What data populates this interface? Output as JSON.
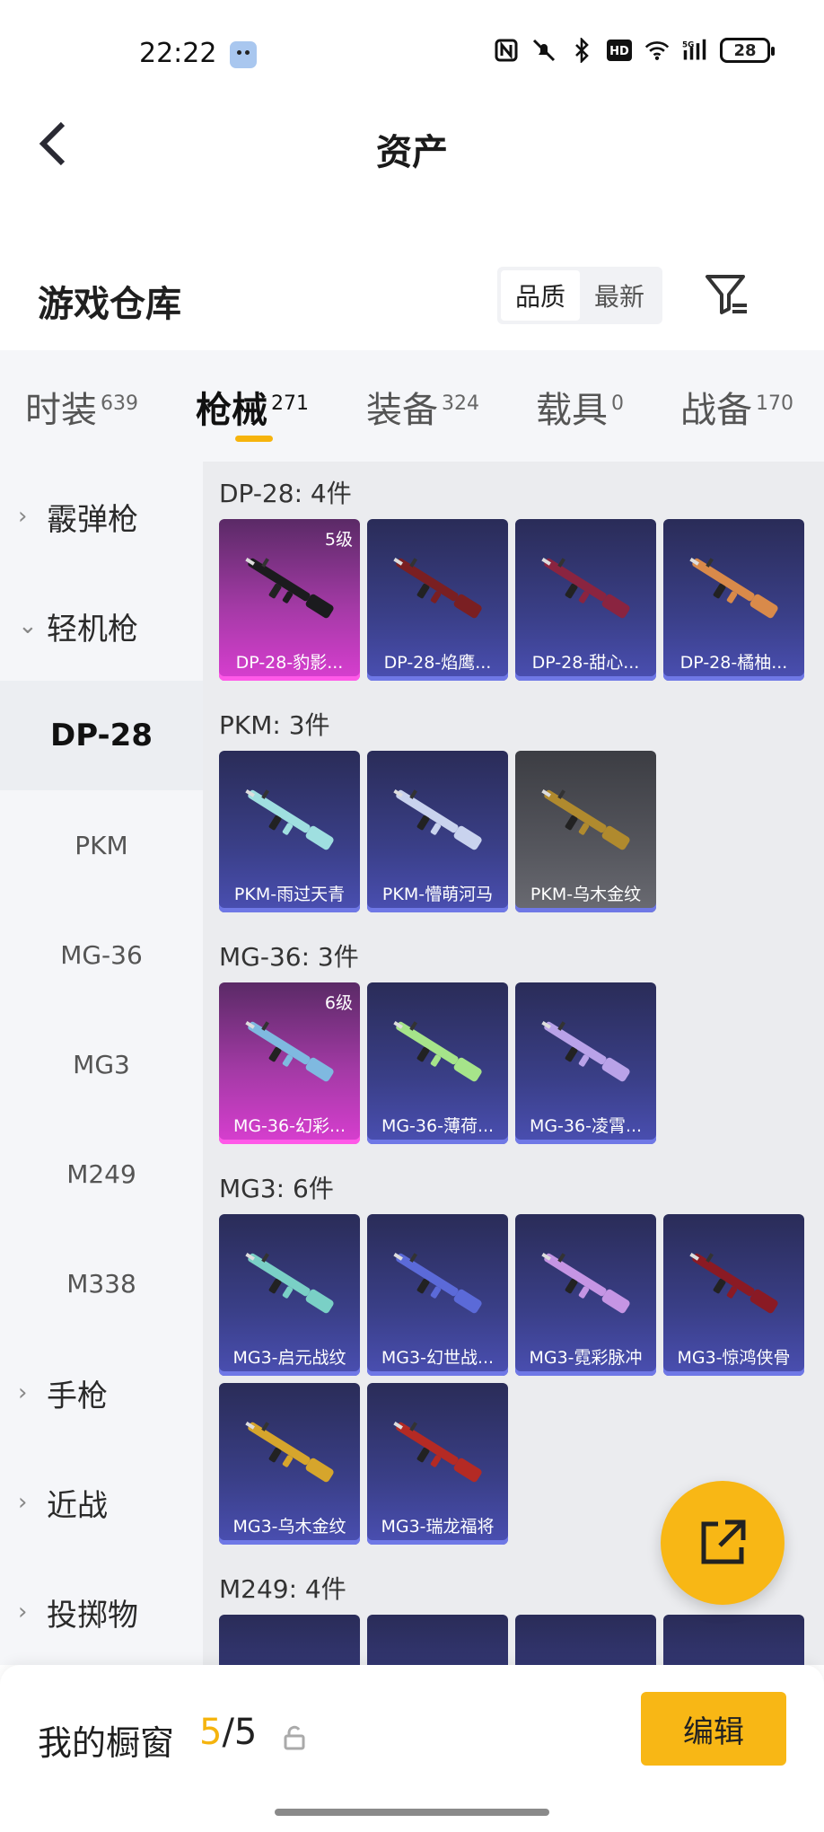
{
  "status_bar": {
    "time": "22:22",
    "battery": "28",
    "network": "5G",
    "hd": "HD"
  },
  "header": {
    "title": "资产"
  },
  "warehouse": {
    "title": "游戏仓库",
    "sort_options": [
      "品质",
      "最新"
    ],
    "sort_selected": "品质"
  },
  "tabs": [
    {
      "label": "时装",
      "count": "639"
    },
    {
      "label": "枪械",
      "count": "271"
    },
    {
      "label": "装备",
      "count": "324"
    },
    {
      "label": "载具",
      "count": "0"
    },
    {
      "label": "战备",
      "count": "170"
    }
  ],
  "sidebar": {
    "categories": {
      "shotgun": "霰弹枪",
      "lmg": "轻机枪",
      "pistol": "手枪",
      "melee": "近战",
      "throwable": "投掷物"
    },
    "subs": [
      "DP-28",
      "PKM",
      "MG-36",
      "MG3",
      "M249",
      "M338"
    ]
  },
  "groups": [
    {
      "title": "DP-28: 4件",
      "items": [
        {
          "name": "DP-28-豹影...",
          "level": "5级",
          "rarity": "pink",
          "color": "#1b1b1e"
        },
        {
          "name": "DP-28-焰鹰...",
          "rarity": "blue",
          "color": "#7a1f22"
        },
        {
          "name": "DP-28-甜心...",
          "rarity": "blue",
          "color": "#8a2440"
        },
        {
          "name": "DP-28-橘柚...",
          "rarity": "blue",
          "color": "#d98a4a"
        }
      ]
    },
    {
      "title": "PKM: 3件",
      "items": [
        {
          "name": "PKM-雨过天青",
          "rarity": "blue",
          "color": "#9fdfe0"
        },
        {
          "name": "PKM-懵萌河马",
          "rarity": "blue",
          "color": "#c9d3ee"
        },
        {
          "name": "PKM-乌木金纹",
          "rarity": "gray",
          "color": "#b08a2e"
        }
      ]
    },
    {
      "title": "MG-36: 3件",
      "items": [
        {
          "name": "MG-36-幻彩...",
          "level": "6级",
          "rarity": "pink",
          "color": "#7fb9e0"
        },
        {
          "name": "MG-36-薄荷...",
          "rarity": "blue",
          "color": "#a6e48a"
        },
        {
          "name": "MG-36-凌霄...",
          "rarity": "blue",
          "color": "#b9a2e8"
        }
      ]
    },
    {
      "title": "MG3: 6件",
      "items": [
        {
          "name": "MG3-启元战纹",
          "rarity": "blue",
          "color": "#7ad0c6"
        },
        {
          "name": "MG3-幻世战...",
          "rarity": "blue",
          "color": "#5b6ad8"
        },
        {
          "name": "MG3-霓彩脉冲",
          "rarity": "blue",
          "color": "#c595e4"
        },
        {
          "name": "MG3-惊鸿侠骨",
          "rarity": "blue",
          "color": "#8a1a24"
        },
        {
          "name": "MG3-乌木金纹",
          "rarity": "blue",
          "color": "#d6a52c"
        },
        {
          "name": "MG3-瑞龙福将",
          "rarity": "blue",
          "color": "#b42a24"
        }
      ]
    },
    {
      "title": "M249: 4件",
      "items": []
    }
  ],
  "showcase": {
    "label": "我的橱窗",
    "current": "5",
    "total": "/5"
  },
  "actions": {
    "edit_label": "编辑"
  },
  "colors": {
    "accent": "#f8b715",
    "blue_rarity": "#6f78e6",
    "pink_rarity": "#ff59e8"
  }
}
